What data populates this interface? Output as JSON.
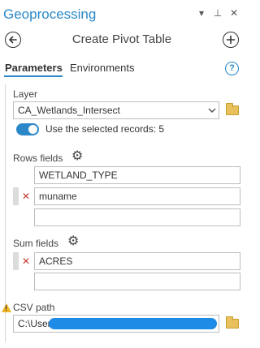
{
  "pane": {
    "title": "Geoprocessing",
    "controls": {
      "menu": "▾",
      "pin": "⊥",
      "close": "✕"
    }
  },
  "tool": {
    "title": "Create Pivot Table",
    "back_icon": "back-arrow-icon",
    "add_icon": "plus-icon"
  },
  "tabs": [
    {
      "label": "Parameters",
      "active": true
    },
    {
      "label": "Environments",
      "active": false
    }
  ],
  "help_glyph": "?",
  "params": {
    "layer": {
      "label": "Layer",
      "value": "CA_Wetlands_Intersect",
      "use_selected_label": "Use the selected records: 5",
      "use_selected_on": true
    },
    "rows_fields": {
      "label": "Rows fields",
      "items": [
        {
          "value": "WETLAND_TYPE",
          "removable": false
        },
        {
          "value": "muname",
          "removable": true
        },
        {
          "value": "",
          "removable": false
        }
      ]
    },
    "sum_fields": {
      "label": "Sum fields",
      "items": [
        {
          "value": "ACRES",
          "removable": true
        },
        {
          "value": "",
          "removable": false
        }
      ]
    },
    "csv_path": {
      "label": "CSV path",
      "value": "C:\\Users",
      "warning": true
    }
  },
  "colors": {
    "accent": "#2b88c8",
    "remove": "#c0392b",
    "warning": "#f0b323",
    "redaction": "#1e8be6"
  }
}
